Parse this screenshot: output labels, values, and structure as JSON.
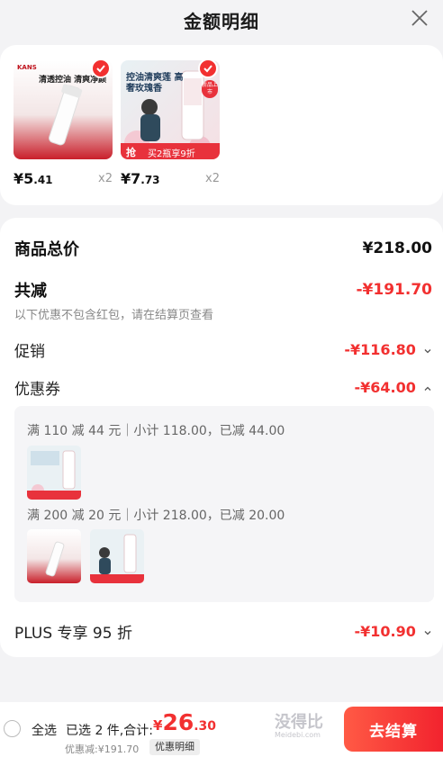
{
  "header": {
    "title": "金额明细"
  },
  "products": [
    {
      "banner": "清透控油 清爽净颜",
      "brand": "KANS",
      "price_int": "¥5",
      "price_dec": ".41",
      "qty": "x2"
    },
    {
      "banner": "控油清爽莲 高奢玫瑰香",
      "promo": "买2瓶享9折",
      "grab": "抢",
      "tag": "新品上市",
      "price_int": "¥7",
      "price_dec": ".73",
      "qty": "x2"
    }
  ],
  "summary": {
    "total_label": "商品总价",
    "total_value": "¥218.00",
    "reduce_label": "共减",
    "reduce_value": "-¥191.70",
    "note": "以下优惠不包含红包，请在结算页查看",
    "promo_label": "促销",
    "promo_value": "-¥116.80",
    "coupon_label": "优惠券",
    "coupon_value": "-¥64.00",
    "plus_label": "PLUS 专享 95 折",
    "plus_value": "-¥10.90"
  },
  "coupons": [
    {
      "text": "满 110 减 44 元｜小计 118.00，已减 44.00"
    },
    {
      "text": "满 200 减 20 元｜小计 218.00，已减 20.00"
    }
  ],
  "bottom": {
    "select_all": "全选",
    "selected": "已选 2 件,合计:",
    "yen": "¥",
    "total_int": "26",
    "total_dec": ".30",
    "saved": "优惠减:¥191.70",
    "detail_btn": "优惠明细",
    "checkout": "去结算"
  },
  "watermark": {
    "main": "没得比",
    "sub": "Meidebi.com"
  },
  "colors": {
    "accent": "#f23030",
    "checkout_start": "#ff5a45",
    "checkout_end": "#f2232e"
  }
}
